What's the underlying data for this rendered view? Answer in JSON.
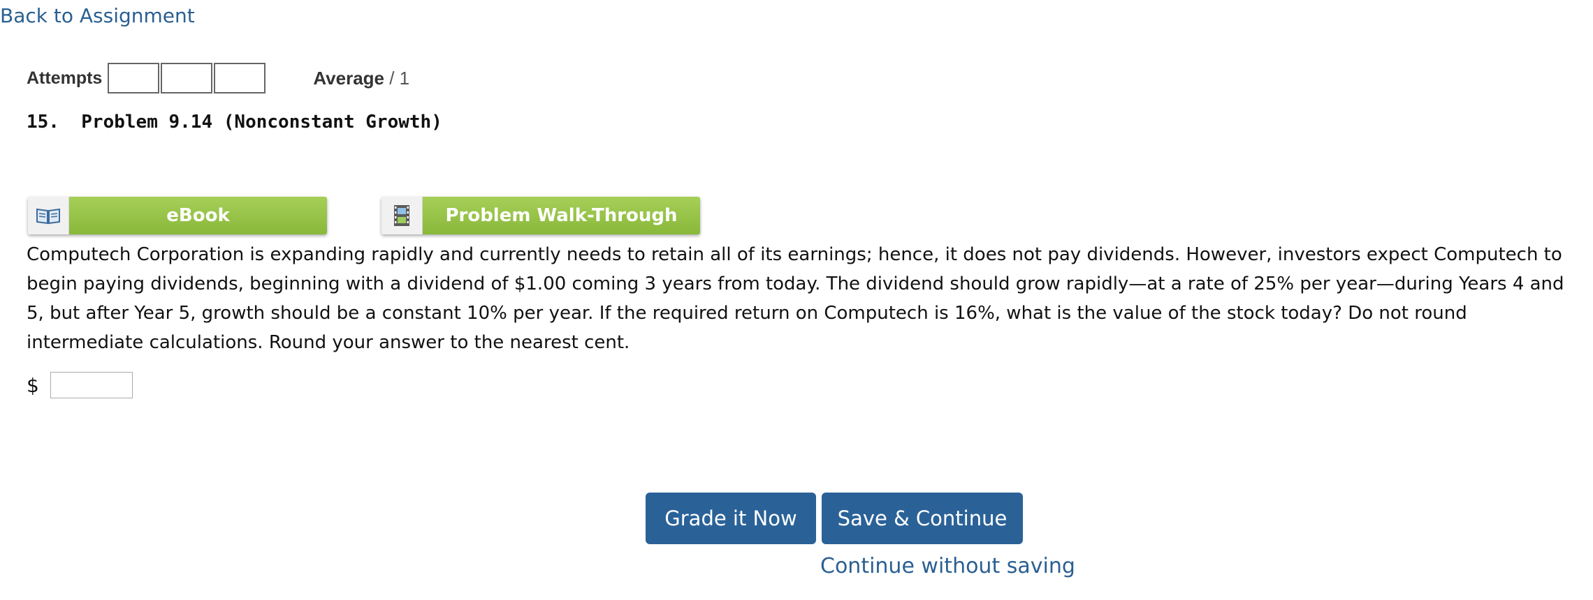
{
  "nav": {
    "back_label": "Back to Assignment"
  },
  "attempts": {
    "label": "Attempts",
    "boxes": [
      "",
      "",
      ""
    ]
  },
  "average": {
    "label": "Average",
    "value": "/ 1"
  },
  "problem": {
    "number": "15.",
    "title": "Problem 9.14 (Nonconstant Growth)",
    "text": "Computech Corporation is expanding rapidly and currently needs to retain all of its earnings; hence, it does not pay dividends. However, investors expect Computech to begin paying dividends, beginning with a dividend of $1.00 coming 3 years from today. The dividend should grow rapidly—at a rate of 25% per year—during Years 4 and 5, but after Year 5, growth should be a constant 10% per year. If the required return on Computech is 16%, what is the value of the stock today? Do not round intermediate calculations. Round your answer to the nearest cent."
  },
  "tools": {
    "ebook": {
      "label": "eBook",
      "icon": "book-icon"
    },
    "walkthrough": {
      "label": "Problem Walk-Through",
      "icon": "film-icon"
    }
  },
  "answer": {
    "currency": "$",
    "value": ""
  },
  "actions": {
    "grade_label": "Grade it Now",
    "save_label": "Save & Continue",
    "continue_label": "Continue without saving"
  },
  "colors": {
    "link": "#2a5f92",
    "primary_button": "#2a6298",
    "tool_green": "#94c447"
  }
}
